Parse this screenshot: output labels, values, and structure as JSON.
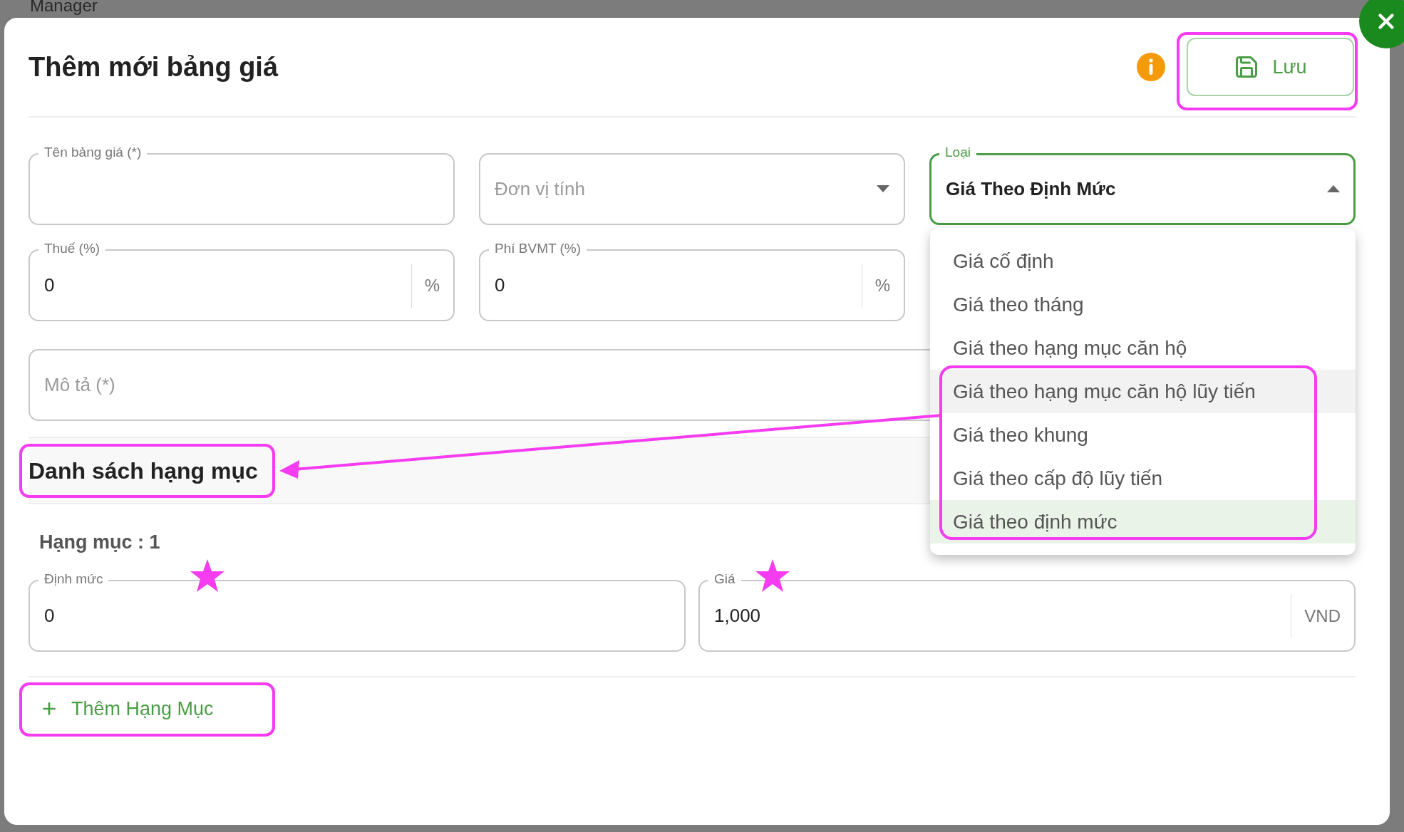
{
  "background": {
    "app_name": "Manager"
  },
  "dialog": {
    "title": "Thêm mới bảng giá",
    "save_button": "Lưu"
  },
  "form_rows": [
    [
      {
        "kind": "text",
        "label": "Tên bảng giá (*)"
      },
      {
        "kind": "select",
        "placeholder": "Đơn vị tính"
      },
      {
        "kind": "select",
        "label": "Loại",
        "value": "Giá Theo Định Mức",
        "focused": true,
        "expanded": true
      }
    ],
    [
      {
        "kind": "text",
        "label": "Thuế (%)",
        "value": "0",
        "suffix": "%"
      },
      {
        "kind": "text",
        "label": "Phí BVMT (%)",
        "value": "0",
        "suffix": "%"
      }
    ]
  ],
  "description": {
    "placeholder": "Mô tả (*)"
  },
  "dropdown_options": [
    {
      "label": "Giá cố định",
      "selected": false,
      "highlighted": false
    },
    {
      "label": "Giá theo tháng",
      "selected": false,
      "highlighted": false
    },
    {
      "label": "Giá theo hạng mục căn hộ",
      "selected": false,
      "highlighted": false
    },
    {
      "label": "Giá theo hạng mục căn hộ lũy tiến",
      "selected": false,
      "highlighted": true
    },
    {
      "label": "Giá theo khung",
      "selected": false,
      "highlighted": false
    },
    {
      "label": "Giá theo cấp độ lũy tiến",
      "selected": false,
      "highlighted": false
    },
    {
      "label": "Giá theo định mức",
      "selected": true,
      "highlighted": false
    }
  ],
  "section": {
    "title": "Danh sách hạng mục"
  },
  "items": [
    {
      "heading": "Hạng mục : 1",
      "fields": [
        {
          "label": "Định mức",
          "value": "0"
        },
        {
          "label": "Giá",
          "value": "1,000",
          "suffix": "VND"
        }
      ]
    }
  ],
  "add_button": "Thêm Hạng Mục"
}
